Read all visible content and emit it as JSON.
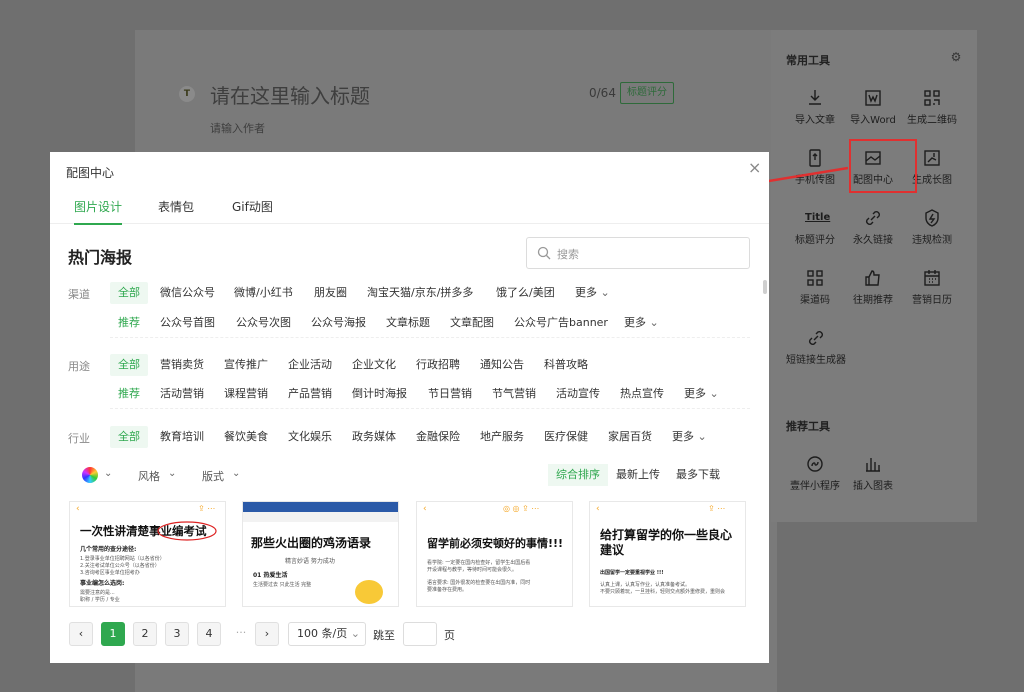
{
  "editor": {
    "avatar_letter": "T",
    "title_placeholder": "请在这里输入标题",
    "count": "0/64",
    "score_badge": "标题评分",
    "author_placeholder": "请输入作者"
  },
  "tools": {
    "common_title": "常用工具",
    "items": [
      {
        "label": "导入文章",
        "icon": "import-article-icon"
      },
      {
        "label": "导入Word",
        "icon": "word-icon"
      },
      {
        "label": "生成二维码",
        "icon": "qrcode-icon"
      },
      {
        "label": "手机传图",
        "icon": "phone-upload-icon"
      },
      {
        "label": "配图中心",
        "icon": "image-center-icon"
      },
      {
        "label": "生成长图",
        "icon": "long-image-icon"
      },
      {
        "label": "标题评分",
        "icon": "title-score-icon"
      },
      {
        "label": "永久链接",
        "icon": "link-icon"
      },
      {
        "label": "违规检测",
        "icon": "shield-check-icon"
      },
      {
        "label": "渠道码",
        "icon": "channel-code-icon"
      },
      {
        "label": "往期推荐",
        "icon": "thumbs-up-icon"
      },
      {
        "label": "营销日历",
        "icon": "calendar-icon"
      },
      {
        "label": "短链接生成器",
        "icon": "short-link-icon"
      }
    ],
    "recommend_title": "推荐工具",
    "recommend_items": [
      {
        "label": "壹伴小程序",
        "icon": "mini-program-icon"
      },
      {
        "label": "插入图表",
        "icon": "chart-icon"
      }
    ],
    "title_icon_text": "Title"
  },
  "modal": {
    "title": "配图中心",
    "close": "×",
    "tabs": [
      "图片设计",
      "表情包",
      "Gif动图"
    ],
    "section_title": "热门海报",
    "search_placeholder": "搜索",
    "filters": {
      "channel_label": "渠道",
      "channel_row1": [
        "全部",
        "微信公众号",
        "微博/小红书",
        "朋友圈",
        "淘宝天猫/京东/拼多多",
        "饿了么/美团",
        "更多"
      ],
      "channel_row2": [
        "推荐",
        "公众号首图",
        "公众号次图",
        "公众号海报",
        "文章标题",
        "文章配图",
        "公众号广告banner",
        "更多"
      ],
      "usage_label": "用途",
      "usage_row1": [
        "全部",
        "营销卖货",
        "宣传推广",
        "企业活动",
        "企业文化",
        "行政招聘",
        "通知公告",
        "科普攻略"
      ],
      "usage_row2": [
        "推荐",
        "活动营销",
        "课程营销",
        "产品营销",
        "倒计时海报",
        "节日营销",
        "节气营销",
        "活动宣传",
        "热点宣传",
        "更多"
      ],
      "industry_label": "行业",
      "industry_row": [
        "全部",
        "教育培训",
        "餐饮美食",
        "文化娱乐",
        "政务媒体",
        "金融保险",
        "地产服务",
        "医疗保健",
        "家居百货",
        "更多"
      ]
    },
    "sort": {
      "style": "风格",
      "layout": "版式",
      "options": [
        "综合排序",
        "最新上传",
        "最多下载"
      ]
    },
    "cards": [
      {
        "title": "一次性讲清楚事业编考试",
        "lines": [
          "几个常用的查分途径:",
          "1.登录事业单位招聘网站（以各省份）",
          "2.关注考试单位公众号（以各省份）",
          "3.咨询考区事业单位招考办",
          "事业编怎么选岗:",
          "需要注意的是...",
          "职称 / 学历 / 专业"
        ]
      },
      {
        "title": "那些火出圈的鸡汤语录",
        "lines": [
          "精言妙语 努力成功",
          "01 热爱生活",
          "生活要过去 只此生活 完整"
        ]
      },
      {
        "title": "留学前必须安顿好的事情!!!",
        "lines": [
          "看学院: 一定要在国内检查好，留学生出国后看",
          "开设课程与教学，等待时间可能会很久。",
          "语言要求: 国外很发的检查要在出国内准，同时",
          "要准备存在费用。"
        ]
      },
      {
        "title": "给打算留学的你一些良心建议",
        "lines": [
          "出国留学一定要重视学业 !!!",
          "认真上课，认真写作业，认真准备考试。",
          "不要只顾着玩，一旦挂科，轻则交点额外重修费，重则会"
        ]
      }
    ],
    "pager": {
      "prev": "‹",
      "pages": [
        "1",
        "2",
        "3",
        "4"
      ],
      "ellipsis": "···",
      "next": "›",
      "page_size": "100 条/页",
      "jump_label": "跳至",
      "page_unit": "页"
    }
  },
  "colors": {
    "accent": "#2fa84f",
    "highlight_box": "#e03030"
  }
}
